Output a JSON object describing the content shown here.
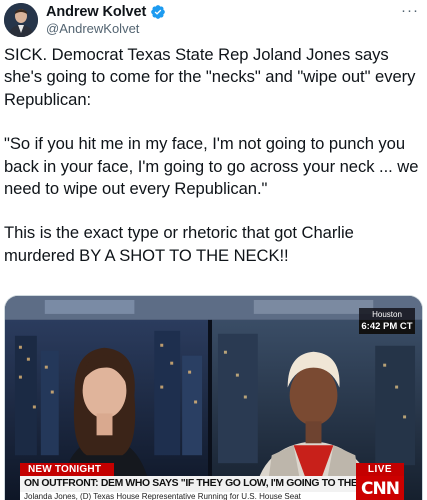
{
  "author": {
    "display_name": "Andrew Kolvet",
    "handle": "@AndrewKolvet",
    "verified_icon": "verified-badge-icon",
    "avatar_icon": "profile-avatar"
  },
  "menu": {
    "more_label": "···"
  },
  "tweet": {
    "paragraph1": "SICK. Democrat Texas State Rep Joland Jones says she's going to come for the \"necks\" and \"wipe out\" every Republican:",
    "paragraph2": "\"So if you hit me in my face, I'm not going to punch you back in your face, I'm going to go across your neck ... we need to wipe out every Republican.\"",
    "paragraph3": "This is the exact type or rhetoric that got Charlie murdered BY A SHOT TO THE NECK!!"
  },
  "media": {
    "location": "Houston",
    "time": "6:42 PM CT",
    "chyron_new": "NEW TONIGHT",
    "chyron_live": "LIVE",
    "chyron_main": "ON OUTFRONT: DEM WHO SAYS \"IF THEY GO LOW, I'M GOING TO THE GUTTER\"",
    "chyron_sub": "Jolanda Jones, (D) Texas House Representative Running for U.S. House Seat",
    "network_logo": "CNN"
  },
  "colors": {
    "verified_blue": "#1d9bf0",
    "text_primary": "#0f1419",
    "text_secondary": "#536471",
    "cnn_red": "#cc0000"
  }
}
